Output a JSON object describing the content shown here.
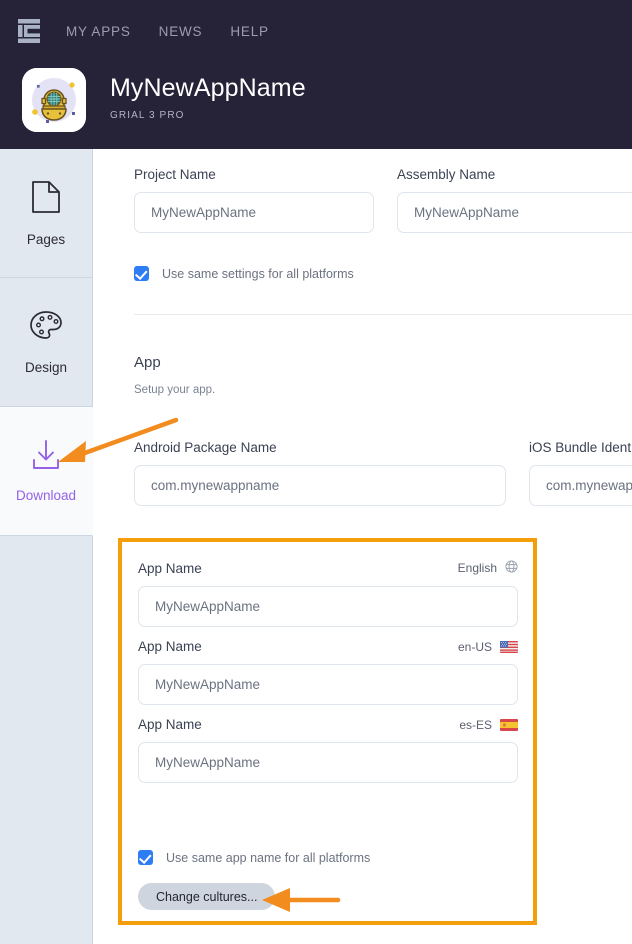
{
  "header": {
    "logo_icon": "grial-g-logo-icon",
    "nav_links": [
      {
        "label": "MY APPS"
      },
      {
        "label": "NEWS"
      },
      {
        "label": "HELP"
      }
    ],
    "app_icon": "diving-helmet-app-icon",
    "app_title": "MyNewAppName",
    "app_subtitle": "GRIAL 3 PRO",
    "background_color": "#262238"
  },
  "sidebar": {
    "items": [
      {
        "label": "Pages",
        "icon": "page-document-icon",
        "active": false
      },
      {
        "label": "Design",
        "icon": "paint-palette-icon",
        "active": false
      },
      {
        "label": "Download",
        "icon": "download-arrow-icon",
        "active": true
      }
    ],
    "active_color": "#9461e8",
    "background_color": "#e2e8f0"
  },
  "main": {
    "project_name": {
      "label": "Project Name",
      "value": "MyNewAppName",
      "placeholder": "MyNewAppName"
    },
    "assembly_name": {
      "label": "Assembly Name",
      "value": "MyNewAppName",
      "placeholder": "MyNewAppName"
    },
    "use_same_settings": {
      "label": "Use same settings for all platforms",
      "checked": true
    },
    "app_section": {
      "title": "App",
      "subtitle": "Setup your app."
    },
    "android_package": {
      "label": "Android Package Name",
      "value": "com.mynewappname",
      "placeholder": "com.mynewappname"
    },
    "ios_bundle": {
      "label": "iOS Bundle Identifier",
      "value": "com.mynewappname",
      "placeholder": "com.mynewappname"
    },
    "app_names": [
      {
        "label": "App Name",
        "culture": "English",
        "culture_icon": "globe-icon",
        "value": "MyNewAppName",
        "placeholder": "MyNewAppName"
      },
      {
        "label": "App Name",
        "culture": "en-US",
        "culture_icon": "flag-us-icon",
        "value": "MyNewAppName",
        "placeholder": "MyNewAppName"
      },
      {
        "label": "App Name",
        "culture": "es-ES",
        "culture_icon": "flag-es-icon",
        "value": "MyNewAppName",
        "placeholder": "MyNewAppName"
      }
    ],
    "use_same_appname": {
      "label": "Use same app name for all platforms",
      "checked": true
    },
    "change_cultures_button": {
      "label": "Change cultures..."
    }
  },
  "annotations": {
    "highlight_color": "#f59e0b",
    "arrow_color": "#f28c1e",
    "arrow_download_target": "download-sidebar-item",
    "arrow_cultures_target": "change-cultures-button"
  }
}
